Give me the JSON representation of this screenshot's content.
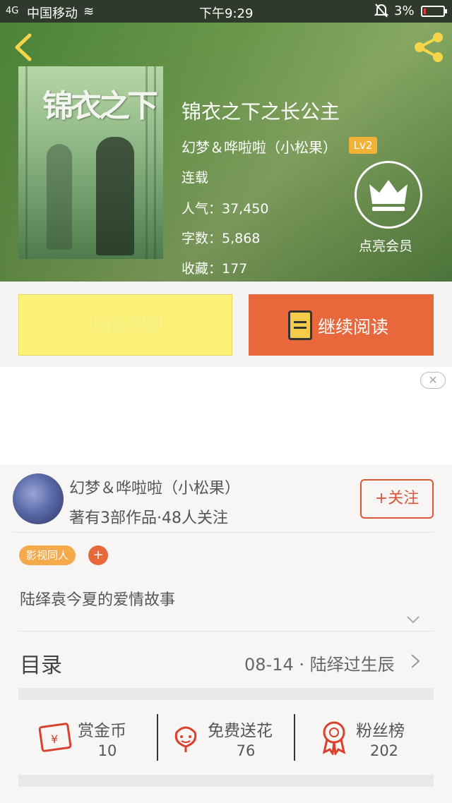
{
  "status_bar": {
    "signal": "4G",
    "carrier": "中国移动",
    "time": "下午9:29",
    "battery": "3%"
  },
  "book": {
    "title": "锦衣之下之长公主",
    "cover_title": "锦衣之下",
    "author": "幻梦＆哗啦啦（小松果）",
    "level": "Lv2",
    "status": "连载",
    "popularity": "人气：37,450",
    "word_count": "字数：5,868",
    "favorites": "收藏：177",
    "vip_label": "点亮会员"
  },
  "actions": {
    "shelf_label": "已在书架",
    "read_label": "继续阅读"
  },
  "author_card": {
    "name": "幻梦＆哗啦啦（小松果）",
    "meta": "著有3部作品·48人关注",
    "follow_label": "+关注"
  },
  "tags": {
    "category": "影视同人",
    "add": "+"
  },
  "description": "陆绎袁今夏的爱情故事",
  "toc": {
    "label": "目录",
    "latest": "08-14 · 陆绎过生辰"
  },
  "stats": [
    {
      "label": "赏金币",
      "value": "10",
      "icon": "red-envelope-icon"
    },
    {
      "label": "免费送花",
      "value": "76",
      "icon": "flower-icon"
    },
    {
      "label": "粉丝榜",
      "value": "202",
      "icon": "award-ribbon-icon"
    }
  ],
  "colors": {
    "accent_orange": "#e8683c",
    "shelf_yellow": "#fcf27a",
    "level_badge": "#f1b235",
    "tag_orange": "#f4a94a",
    "icon_red": "#d9412e"
  }
}
